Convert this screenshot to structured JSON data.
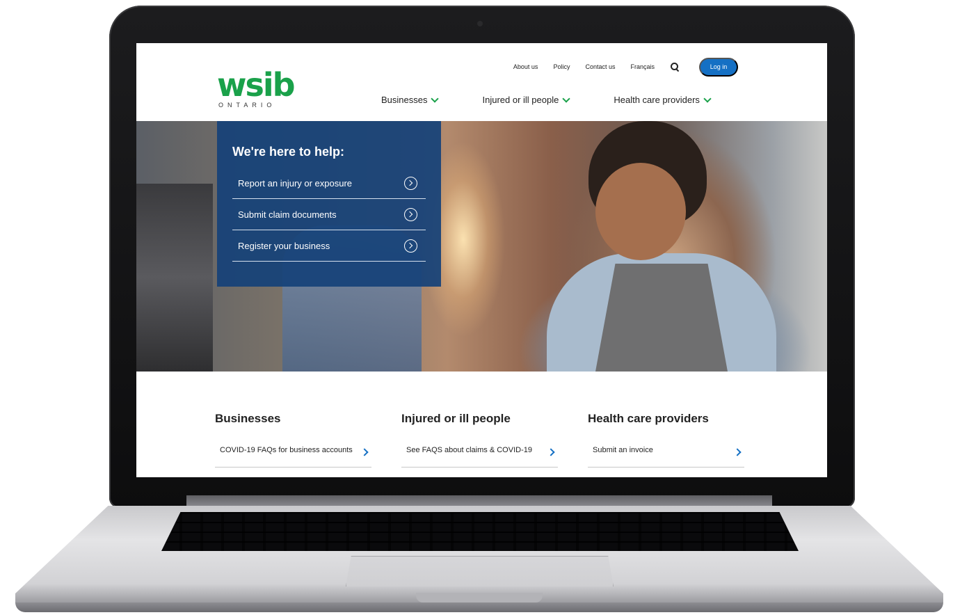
{
  "header": {
    "logo_word": "wsib",
    "logo_sub": "ONTARIO",
    "util_links": [
      "About us",
      "Policy",
      "Contact us",
      "Français"
    ],
    "login_label": "Log in",
    "main_nav": [
      "Businesses",
      "Injured or ill people",
      "Health care providers"
    ]
  },
  "hero": {
    "title": "We're here to help:",
    "items": [
      "Report an injury or exposure",
      "Submit claim documents",
      "Register your business"
    ]
  },
  "sections": [
    {
      "title": "Businesses",
      "link": "COVID-19 FAQs for business accounts"
    },
    {
      "title": "Injured or ill people",
      "link": "See FAQS about claims & COVID-19"
    },
    {
      "title": "Health care providers",
      "link": "Submit an invoice"
    }
  ],
  "colors": {
    "brand_green": "#1aa14a",
    "brand_blue": "#1570c4",
    "panel_blue": "#164278"
  }
}
